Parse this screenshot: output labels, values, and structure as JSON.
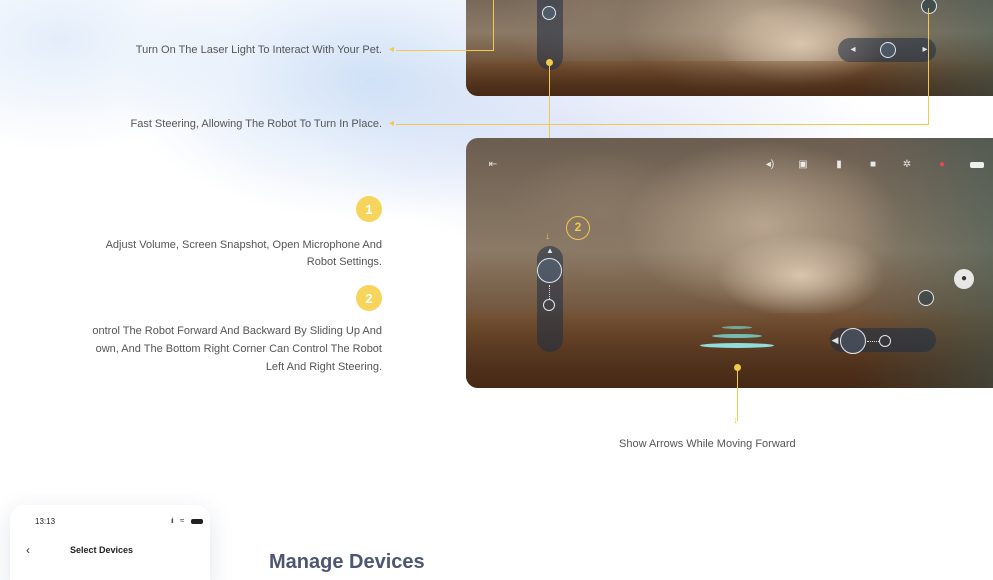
{
  "captions": {
    "laser": "Turn On The Laser Light To Interact With Your Pet.",
    "steering": "Fast Steering, Allowing The Robot To Turn In Place.",
    "badge1": "1",
    "item1_line1": "Adjust Volume, Screen Snapshot, Open Microphone And",
    "item1_line2": "Robot Settings.",
    "badge2": "2",
    "item2_line1": "ontrol The Robot Forward And Backward By Sliding Up And",
    "item2_line2": "own, And The Bottom Right Corner Can Control The Robot",
    "item2_line3": "Left And Right Steering.",
    "callout2": "2",
    "arrows_note": "Show Arrows While Moving Forward"
  },
  "phone": {
    "time": "13:13",
    "back_glyph": "‹",
    "title": "Select Devices",
    "status_icons": [
      "signal-icon",
      "wifi-icon",
      "battery-icon"
    ]
  },
  "section": {
    "title": "Manage Devices"
  },
  "hud_icons": [
    "exit-icon",
    "volume-icon",
    "snapshot-icon",
    "microphone-icon",
    "video-icon",
    "settings-icon",
    "record-icon",
    "battery-icon",
    "paw-icon"
  ],
  "colors": {
    "accent_yellow": "#f2c94c",
    "badge_yellow": "#f7d45b",
    "record_red": "#e5484d",
    "text_gray": "#555555"
  }
}
